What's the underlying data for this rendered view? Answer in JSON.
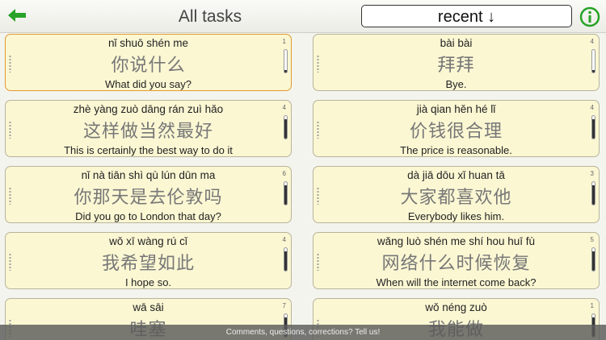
{
  "header": {
    "title": "All tasks",
    "sort_label": "recent ↓",
    "back_icon": "left-arrow-icon",
    "info_icon": "info-icon",
    "accent": "#27a327"
  },
  "cards": [
    {
      "pinyin": "nǐ shuō shén me",
      "hanzi": "你说什么",
      "english": "What did you say?",
      "count": "1",
      "level": 0.1,
      "selected": true
    },
    {
      "pinyin": "bài bài",
      "hanzi": "拜拜",
      "english": "Bye.",
      "count": "4",
      "level": 0.1,
      "selected": false
    },
    {
      "pinyin": "zhè yàng zuò dāng rán zuì hǎo",
      "hanzi": "这样做当然最好",
      "english": "This is certainly the best way to do it",
      "count": "4",
      "level": 0.85,
      "selected": false
    },
    {
      "pinyin": "jià qian hěn hé lǐ",
      "hanzi": "价钱很合理",
      "english": "The price is reasonable.",
      "count": "4",
      "level": 0.85,
      "selected": false
    },
    {
      "pinyin": "nǐ nà tiān shì qù lún dūn ma",
      "hanzi": "你那天是去伦敦吗",
      "english": "Did you go to London that day?",
      "count": "6",
      "level": 0.85,
      "selected": false
    },
    {
      "pinyin": "dà jiā dōu xǐ huan tā",
      "hanzi": "大家都喜欢他",
      "english": "Everybody likes him.",
      "count": "3",
      "level": 0.85,
      "selected": false
    },
    {
      "pinyin": "wǒ xī wàng rú cǐ",
      "hanzi": "我希望如此",
      "english": "I hope so.",
      "count": "4",
      "level": 0.85,
      "selected": false
    },
    {
      "pinyin": "wǎng luò shén me shí hou huī fù",
      "hanzi": "网络什么时候恢复",
      "english": "When will the internet come back?",
      "count": "5",
      "level": 0.85,
      "selected": false
    },
    {
      "pinyin": "wā sāi",
      "hanzi": "哇塞",
      "english": "",
      "count": "7",
      "level": 0.85,
      "selected": false
    },
    {
      "pinyin": "wǒ néng zuò",
      "hanzi": "我能做",
      "english": "",
      "count": "1",
      "level": 0.85,
      "selected": false
    }
  ],
  "footer": {
    "text": "Comments, questions, corrections? Tell us!"
  }
}
